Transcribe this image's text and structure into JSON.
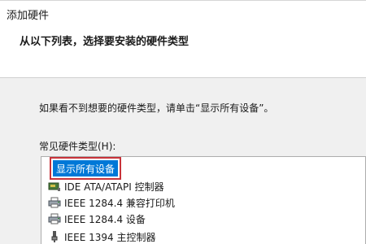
{
  "window": {
    "title": "添加硬件"
  },
  "header": {
    "title": "从以下列表，选择要安装的硬件类型"
  },
  "content": {
    "instruction": "如果看不到想要的硬件类型，请单击“显示所有设备”。",
    "list_label": "常见硬件类型(H):",
    "items": [
      {
        "label": "显示所有设备",
        "icon": "none",
        "selected": true
      },
      {
        "label": "IDE ATA/ATAPI 控制器",
        "icon": "ide-controller-icon"
      },
      {
        "label": "IEEE 1284.4 兼容打印机",
        "icon": "printer-icon"
      },
      {
        "label": "IEEE 1284.4 设备",
        "icon": "printer-icon"
      },
      {
        "label": "IEEE 1394 主控制器",
        "icon": "usb-controller-icon"
      }
    ]
  },
  "colors": {
    "selection_bg": "#0078d7",
    "highlight_border": "#c8333a"
  }
}
